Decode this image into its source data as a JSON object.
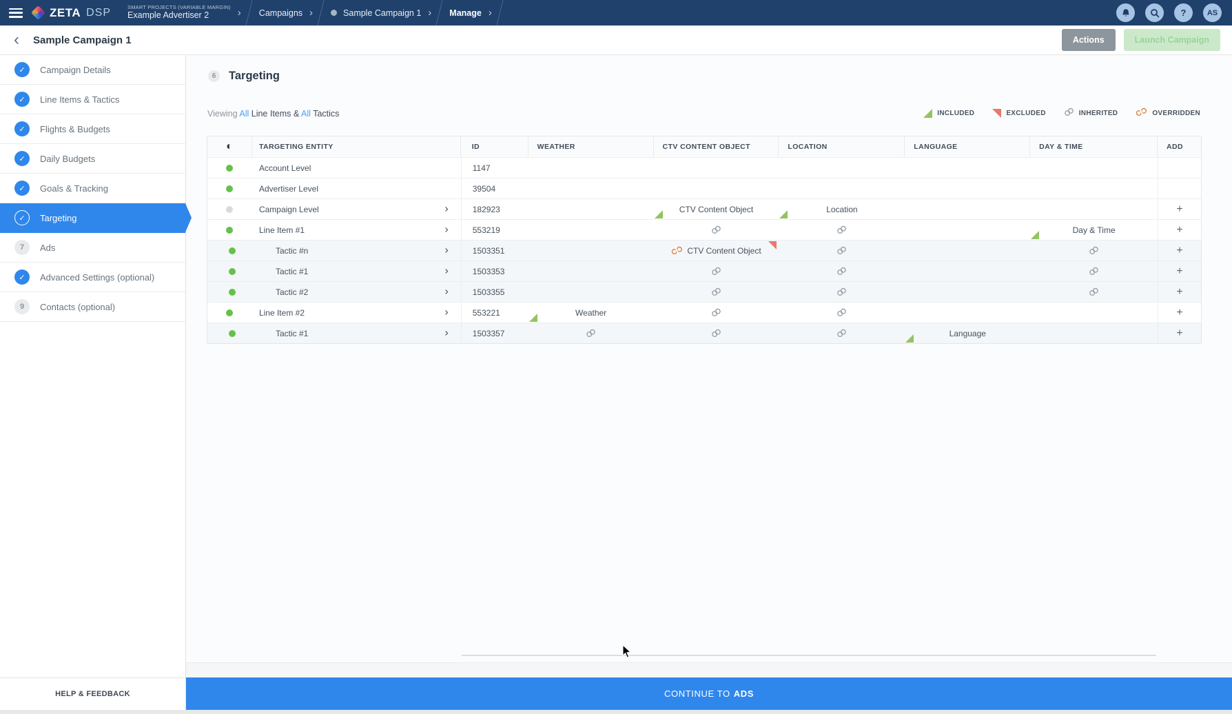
{
  "colors": {
    "navbar": "#20416b",
    "accent": "#2f87ec",
    "dot-green": "#65c148",
    "included": "#94c45f",
    "excluded": "#e8796b",
    "inherited": "#9aa3ac",
    "overridden": "#e2823f"
  },
  "navbar": {
    "logo": {
      "zeta": "ZETA",
      "dsp": "DSP"
    },
    "breadcrumbs": [
      {
        "label_small": "SMART PROJECTS (VARIABLE MARGIN)",
        "label": "Example Advertiser 2"
      },
      {
        "label": "Campaigns"
      },
      {
        "label": "Sample Campaign 1",
        "dot": true
      },
      {
        "label": "Manage",
        "bold": true
      }
    ],
    "avatar_initials": "AS",
    "help_glyph": "?"
  },
  "title_bar": {
    "title": "Sample Campaign 1",
    "actions_label": "Actions",
    "launch_label": "Launch Campaign"
  },
  "sidebar": {
    "items": [
      {
        "label": "Campaign Details",
        "state": "done"
      },
      {
        "label": "Line Items & Tactics",
        "state": "done"
      },
      {
        "label": "Flights & Budgets",
        "state": "done"
      },
      {
        "label": "Daily Budgets",
        "state": "done"
      },
      {
        "label": "Goals & Tracking",
        "state": "done"
      },
      {
        "label": "Targeting",
        "state": "active"
      },
      {
        "label": "Ads",
        "state": "todo",
        "number": "7"
      },
      {
        "label": "Advanced Settings (optional)",
        "state": "done"
      },
      {
        "label": "Contacts (optional)",
        "state": "todo",
        "number": "9"
      }
    ],
    "help_label": "HELP & FEEDBACK"
  },
  "main": {
    "step_number": "6",
    "heading": "Targeting",
    "viewing": {
      "prefix": "Viewing",
      "all1": "All",
      "mid": "Line Items &",
      "all2": "All",
      "suffix": "Tactics"
    },
    "legend": [
      {
        "icon": "included-triangle",
        "label": "INCLUDED"
      },
      {
        "icon": "excluded-triangle",
        "label": "EXCLUDED"
      },
      {
        "icon": "inherited-link",
        "label": "INHERITED"
      },
      {
        "icon": "overridden-link",
        "label": "OVERRIDDEN"
      }
    ],
    "table": {
      "columns": [
        {
          "id": "status",
          "label": ""
        },
        {
          "id": "entity",
          "label": "TARGETING ENTITY"
        },
        {
          "id": "rowid",
          "label": "ID"
        },
        {
          "id": "weather",
          "label": "WEATHER"
        },
        {
          "id": "ctv",
          "label": "CTV CONTENT OBJECT"
        },
        {
          "id": "location",
          "label": "LOCATION"
        },
        {
          "id": "language",
          "label": "LANGUAGE"
        },
        {
          "id": "daytime",
          "label": "DAY & TIME"
        },
        {
          "id": "add",
          "label": "ADD"
        }
      ],
      "rows": [
        {
          "entity": "Account Level",
          "id": "1147",
          "dot": "green",
          "expandable": false,
          "tactic": false,
          "tinted": false,
          "add": false,
          "cells": {}
        },
        {
          "entity": "Advertiser Level",
          "id": "39504",
          "dot": "green",
          "expandable": false,
          "tactic": false,
          "tinted": false,
          "add": false,
          "cells": {}
        },
        {
          "entity": "Campaign Level",
          "id": "182923",
          "dot": "gray",
          "expandable": true,
          "tactic": false,
          "tinted": false,
          "add": true,
          "cells": {
            "ctv": {
              "type": "included",
              "label": "CTV Content Object"
            },
            "location": {
              "type": "included",
              "label": "Location"
            }
          }
        },
        {
          "entity": "Line Item #1",
          "id": "553219",
          "dot": "green",
          "expandable": true,
          "tactic": false,
          "tinted": false,
          "add": true,
          "cells": {
            "ctv": {
              "type": "inherited"
            },
            "location": {
              "type": "inherited"
            },
            "daytime": {
              "type": "included",
              "label": "Day & Time"
            }
          }
        },
        {
          "entity": "Tactic #n",
          "id": "1503351",
          "dot": "green",
          "expandable": true,
          "tactic": true,
          "tinted": true,
          "add": true,
          "cells": {
            "ctv": {
              "type": "overridden",
              "label": "CTV Content Object",
              "excluded": true
            },
            "location": {
              "type": "inherited"
            },
            "daytime": {
              "type": "inherited"
            }
          }
        },
        {
          "entity": "Tactic #1",
          "id": "1503353",
          "dot": "green",
          "expandable": true,
          "tactic": true,
          "tinted": true,
          "add": true,
          "cells": {
            "ctv": {
              "type": "inherited"
            },
            "location": {
              "type": "inherited"
            },
            "daytime": {
              "type": "inherited"
            }
          }
        },
        {
          "entity": "Tactic #2",
          "id": "1503355",
          "dot": "green",
          "expandable": true,
          "tactic": true,
          "tinted": true,
          "add": true,
          "cells": {
            "ctv": {
              "type": "inherited"
            },
            "location": {
              "type": "inherited"
            },
            "daytime": {
              "type": "inherited"
            }
          }
        },
        {
          "entity": "Line Item #2",
          "id": "553221",
          "dot": "green",
          "expandable": true,
          "tactic": false,
          "tinted": false,
          "add": true,
          "cells": {
            "weather": {
              "type": "included",
              "label": "Weather"
            },
            "ctv": {
              "type": "inherited"
            },
            "location": {
              "type": "inherited"
            }
          }
        },
        {
          "entity": "Tactic #1",
          "id": "1503357",
          "dot": "green",
          "expandable": true,
          "tactic": true,
          "tinted": true,
          "add": true,
          "cells": {
            "weather": {
              "type": "inherited"
            },
            "ctv": {
              "type": "inherited"
            },
            "location": {
              "type": "inherited"
            },
            "language": {
              "type": "included",
              "label": "Language"
            }
          }
        }
      ]
    }
  },
  "footer": {
    "continue_prefix": "CONTINUE TO",
    "continue_bold": "ADS"
  }
}
